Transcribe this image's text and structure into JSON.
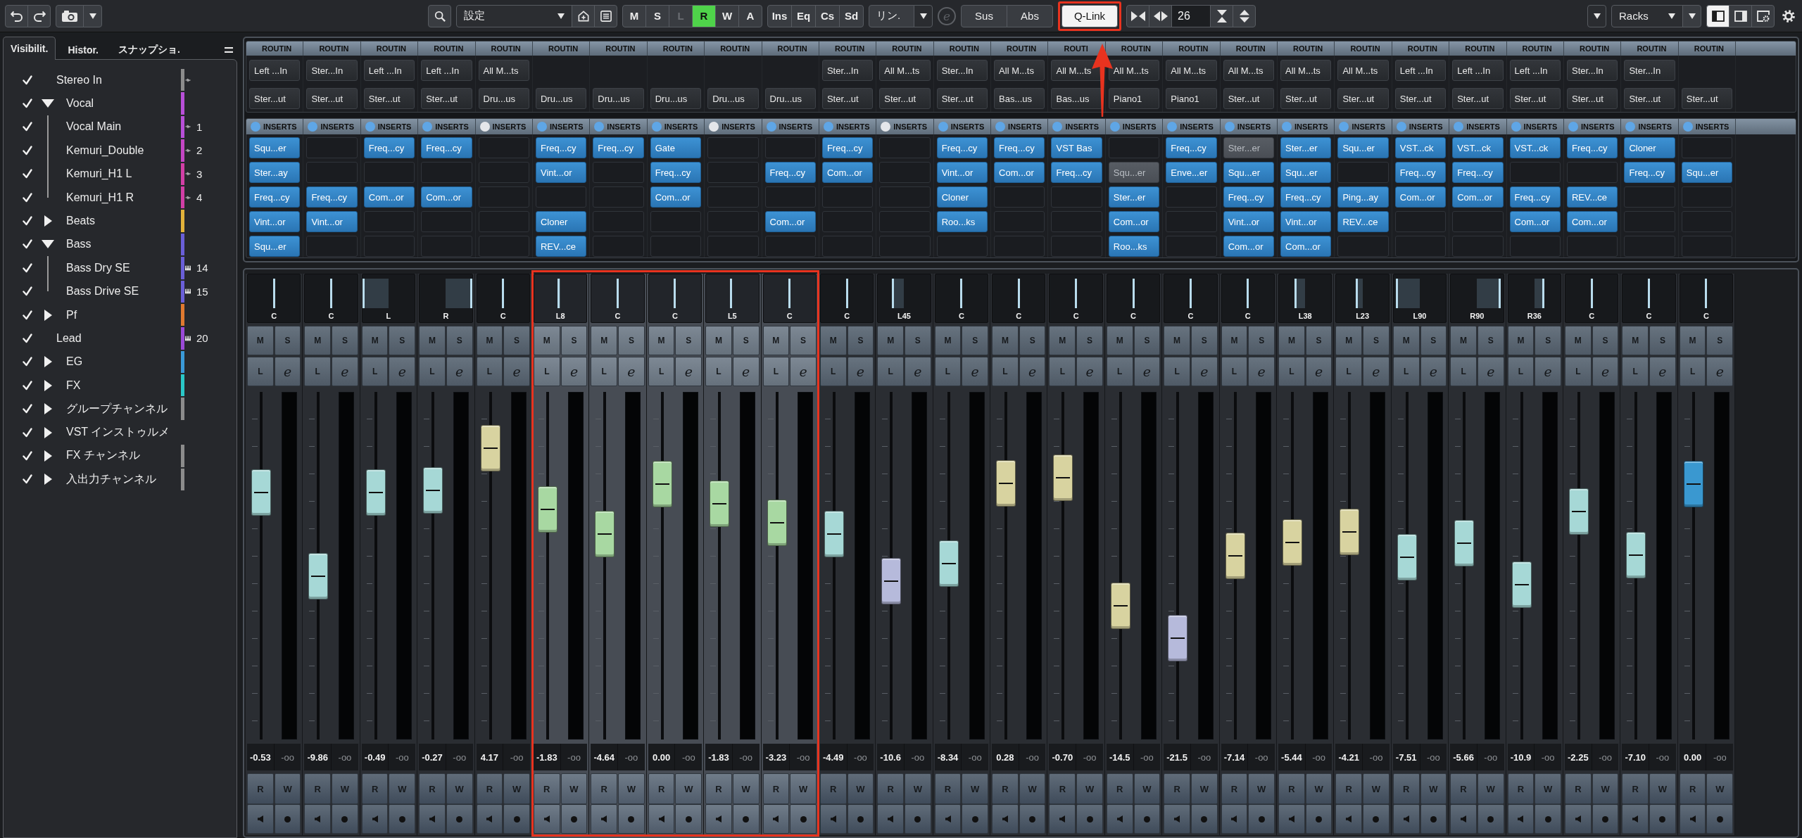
{
  "toolbar": {
    "config": {
      "value": "設定"
    },
    "modes": [
      {
        "label": "M",
        "on": false,
        "disabled": false
      },
      {
        "label": "S",
        "on": false,
        "disabled": false
      },
      {
        "label": "L",
        "on": false,
        "disabled": true
      },
      {
        "label": "R",
        "on": true,
        "disabled": false
      },
      {
        "label": "W",
        "on": false,
        "disabled": false
      },
      {
        "label": "A",
        "on": false,
        "disabled": false
      }
    ],
    "racks": [
      {
        "label": "Ins"
      },
      {
        "label": "Eq"
      },
      {
        "label": "Cs"
      },
      {
        "label": "Sd"
      }
    ],
    "link": {
      "value": "リン."
    },
    "edit": {
      "label": "e",
      "disabled": true
    },
    "scope": [
      {
        "label": "Sus"
      },
      {
        "label": "Abs"
      }
    ],
    "qlink": {
      "label": "Q-Link",
      "on": true
    },
    "channel_count": "26",
    "rack_menu": {
      "value": "Racks"
    },
    "layout": [
      {
        "selected": true
      },
      {
        "selected": false
      },
      {
        "selected": false
      }
    ]
  },
  "sidebar": {
    "tabs": [
      {
        "label": "Visibilit.",
        "selected": true
      },
      {
        "label": "Histor.",
        "selected": false
      },
      {
        "label": "スナップショ.",
        "selected": false
      }
    ],
    "tree": [
      {
        "label": "Stereo In",
        "kind": "audio",
        "visible": true,
        "color": "#8c8c8c"
      },
      {
        "label": "Vocal",
        "kind": "folder",
        "visible": true,
        "expanded": true,
        "color": "#b84fd8",
        "children": [
          {
            "label": "Vocal Main",
            "kind": "audio",
            "visible": true,
            "color": "#b84fd8",
            "number": "1"
          },
          {
            "label": "Kemuri_Double",
            "kind": "audio",
            "visible": true,
            "color": "#c446c4",
            "number": "2"
          },
          {
            "label": "Kemuri_H1 L",
            "kind": "audio",
            "visible": true,
            "color": "#d23fa6",
            "number": "3"
          },
          {
            "label": "Kemuri_H1 R",
            "kind": "audio",
            "visible": true,
            "color": "#d23fa6",
            "number": "4"
          }
        ]
      },
      {
        "label": "Beats",
        "kind": "folder",
        "visible": true,
        "expanded": false,
        "color": "#e2b23a"
      },
      {
        "label": "Bass",
        "kind": "folder",
        "visible": true,
        "expanded": true,
        "color": "#6a5fd8",
        "children": [
          {
            "label": "Bass Dry SE",
            "kind": "instrument",
            "visible": true,
            "color": "#6a5fd8",
            "number": "14"
          },
          {
            "label": "Bass Drive SE",
            "kind": "instrument",
            "visible": true,
            "color": "#6a5fd8",
            "number": "15"
          }
        ]
      },
      {
        "label": "Pf",
        "kind": "folder",
        "visible": true,
        "expanded": false,
        "color": "#e07a30"
      },
      {
        "label": "Lead",
        "kind": "instrument",
        "visible": true,
        "color": "#9a4ad8",
        "number": "20"
      },
      {
        "label": "EG",
        "kind": "folder",
        "visible": true,
        "expanded": false,
        "color": "#3a9ad8"
      },
      {
        "label": "FX",
        "kind": "folder",
        "visible": true,
        "expanded": false,
        "color": "#2ac8c8"
      },
      {
        "label": "グループチャンネル",
        "kind": "folder",
        "visible": true,
        "expanded": false,
        "color": "#8c8c8c"
      },
      {
        "label": "VST インストゥルメ",
        "kind": "folder",
        "visible": true,
        "expanded": false
      },
      {
        "label": "FX チャンネル",
        "kind": "folder",
        "visible": true,
        "expanded": false,
        "color": "#8c8c8c"
      },
      {
        "label": "入出力チャンネル",
        "kind": "folder",
        "visible": true,
        "expanded": false,
        "color": "#8c8c8c"
      }
    ]
  },
  "rack": {
    "columns": [
      {
        "routing_label": "ROUTIN",
        "input": "Left ...In",
        "output": "Ster...ut",
        "inserts_label": "INSERTS",
        "inserts_on": true,
        "inserts": [
          {
            "kind": "plugin",
            "name": "Squ...er"
          },
          {
            "kind": "plugin",
            "name": "Ster...ay"
          },
          {
            "kind": "plugin",
            "name": "Freq...cy"
          },
          {
            "kind": "plugin",
            "name": "Vint...or"
          },
          {
            "kind": "plugin",
            "name": "Squ...er"
          }
        ]
      },
      {
        "routing_label": "ROUTIN",
        "input": "Ster...In",
        "output": "Ster...ut",
        "inserts_label": "INSERTS",
        "inserts_on": true,
        "inserts": [
          {
            "kind": "empty"
          },
          {
            "kind": "empty"
          },
          {
            "kind": "plugin",
            "name": "Freq...cy"
          },
          {
            "kind": "plugin",
            "name": "Vint...or"
          },
          {
            "kind": "empty"
          }
        ]
      },
      {
        "routing_label": "ROUTIN",
        "input": "Left ...In",
        "output": "Ster...ut",
        "inserts_label": "INSERTS",
        "inserts_on": true,
        "inserts": [
          {
            "kind": "plugin",
            "name": "Freq...cy"
          },
          {
            "kind": "empty"
          },
          {
            "kind": "plugin",
            "name": "Com...or"
          },
          {
            "kind": "empty"
          },
          {
            "kind": "empty"
          }
        ]
      },
      {
        "routing_label": "ROUTIN",
        "input": "Left ...In",
        "output": "Ster...ut",
        "inserts_label": "INSERTS",
        "inserts_on": true,
        "inserts": [
          {
            "kind": "plugin",
            "name": "Freq...cy"
          },
          {
            "kind": "empty"
          },
          {
            "kind": "plugin",
            "name": "Com...or"
          },
          {
            "kind": "empty"
          },
          {
            "kind": "empty"
          }
        ]
      },
      {
        "routing_label": "ROUTIN",
        "input": "All M...ts",
        "output": "Dru...us",
        "inserts_label": "INSERTS",
        "inserts_on": false,
        "inserts": [
          {
            "kind": "empty"
          },
          {
            "kind": "empty"
          },
          {
            "kind": "empty"
          },
          {
            "kind": "empty"
          },
          {
            "kind": "empty"
          }
        ]
      },
      {
        "routing_label": "ROUTIN",
        "output": "Dru...us",
        "inserts_label": "INSERTS",
        "inserts_on": true,
        "inserts": [
          {
            "kind": "plugin",
            "name": "Freq...cy"
          },
          {
            "kind": "plugin",
            "name": "Vint...or"
          },
          {
            "kind": "empty"
          },
          {
            "kind": "plugin",
            "name": "Cloner"
          },
          {
            "kind": "plugin",
            "name": "REV...ce"
          }
        ]
      },
      {
        "routing_label": "ROUTIN",
        "output": "Dru...us",
        "inserts_label": "INSERTS",
        "inserts_on": true,
        "inserts": [
          {
            "kind": "plugin",
            "name": "Freq...cy"
          },
          {
            "kind": "empty"
          },
          {
            "kind": "empty"
          },
          {
            "kind": "empty"
          },
          {
            "kind": "empty"
          }
        ]
      },
      {
        "routing_label": "ROUTIN",
        "output": "Dru...us",
        "inserts_label": "INSERTS",
        "inserts_on": true,
        "inserts": [
          {
            "kind": "plugin",
            "name": "Gate"
          },
          {
            "kind": "plugin",
            "name": "Freq...cy"
          },
          {
            "kind": "plugin",
            "name": "Com...or"
          },
          {
            "kind": "empty"
          },
          {
            "kind": "empty"
          }
        ]
      },
      {
        "routing_label": "ROUTIN",
        "output": "Dru...us",
        "inserts_label": "INSERTS",
        "inserts_on": false,
        "inserts": [
          {
            "kind": "empty"
          },
          {
            "kind": "empty"
          },
          {
            "kind": "empty"
          },
          {
            "kind": "empty"
          },
          {
            "kind": "empty"
          }
        ]
      },
      {
        "routing_label": "ROUTIN",
        "output": "Dru...us",
        "inserts_label": "INSERTS",
        "inserts_on": true,
        "inserts": [
          {
            "kind": "empty"
          },
          {
            "kind": "plugin",
            "name": "Freq...cy"
          },
          {
            "kind": "empty"
          },
          {
            "kind": "plugin",
            "name": "Com...or"
          },
          {
            "kind": "empty"
          }
        ]
      },
      {
        "routing_label": "ROUTIN",
        "input": "Ster...In",
        "output": "Ster...ut",
        "inserts_label": "INSERTS",
        "inserts_on": true,
        "inserts": [
          {
            "kind": "plugin",
            "name": "Freq...cy"
          },
          {
            "kind": "plugin",
            "name": "Com...or"
          },
          {
            "kind": "empty"
          },
          {
            "kind": "empty"
          },
          {
            "kind": "empty"
          }
        ]
      },
      {
        "routing_label": "ROUTIN",
        "input": "All M...ts",
        "output": "Ster...ut",
        "inserts_label": "INSERTS",
        "inserts_on": false,
        "inserts": [
          {
            "kind": "empty"
          },
          {
            "kind": "empty"
          },
          {
            "kind": "empty"
          },
          {
            "kind": "empty"
          },
          {
            "kind": "empty"
          }
        ]
      },
      {
        "routing_label": "ROUTIN",
        "input": "Ster...In",
        "output": "Ster...ut",
        "inserts_label": "INSERTS",
        "inserts_on": true,
        "inserts": [
          {
            "kind": "plugin",
            "name": "Freq...cy"
          },
          {
            "kind": "plugin",
            "name": "Vint...or"
          },
          {
            "kind": "plugin",
            "name": "Cloner"
          },
          {
            "kind": "plugin",
            "name": "Roo...ks"
          },
          {
            "kind": "empty"
          }
        ]
      },
      {
        "routing_label": "ROUTIN",
        "input": "All M...ts",
        "output": "Bas...us",
        "inserts_label": "INSERTS",
        "inserts_on": true,
        "inserts": [
          {
            "kind": "plugin",
            "name": "Freq...cy"
          },
          {
            "kind": "plugin",
            "name": "Com...or"
          },
          {
            "kind": "empty"
          },
          {
            "kind": "empty"
          },
          {
            "kind": "empty"
          }
        ]
      },
      {
        "routing_label": "ROUTI",
        "input": "All M...ts",
        "output": "Bas...us",
        "inserts_label": "INSERTS",
        "inserts_on": true,
        "inserts": [
          {
            "kind": "plugin",
            "name": "VST Bas"
          },
          {
            "kind": "plugin",
            "name": "Freq...cy"
          },
          {
            "kind": "empty"
          },
          {
            "kind": "empty"
          },
          {
            "kind": "empty"
          }
        ]
      },
      {
        "routing_label": "ROUTIN",
        "input": "All M...ts",
        "output": "Piano1",
        "inserts_label": "INSERTS",
        "inserts_on": true,
        "inserts": [
          {
            "kind": "empty"
          },
          {
            "kind": "bypassed",
            "name": "Squ...er"
          },
          {
            "kind": "plugin",
            "name": "Ster...er"
          },
          {
            "kind": "plugin",
            "name": "Com...or"
          },
          {
            "kind": "plugin",
            "name": "Roo...ks"
          }
        ]
      },
      {
        "routing_label": "ROUTIN",
        "input": "All M...ts",
        "output": "Piano1",
        "inserts_label": "INSERTS",
        "inserts_on": true,
        "inserts": [
          {
            "kind": "plugin",
            "name": "Freq...cy"
          },
          {
            "kind": "plugin",
            "name": "Enve...er"
          },
          {
            "kind": "empty"
          },
          {
            "kind": "empty"
          },
          {
            "kind": "empty"
          }
        ]
      },
      {
        "routing_label": "ROUTIN",
        "input": "All M...ts",
        "output": "Ster...ut",
        "inserts_label": "INSERTS",
        "inserts_on": true,
        "inserts": [
          {
            "kind": "bypassed",
            "name": "Ster...er"
          },
          {
            "kind": "plugin",
            "name": "Squ...er"
          },
          {
            "kind": "plugin",
            "name": "Freq...cy"
          },
          {
            "kind": "plugin",
            "name": "Vint...or"
          },
          {
            "kind": "plugin",
            "name": "Com...or"
          }
        ]
      },
      {
        "routing_label": "ROUTIN",
        "input": "All M...ts",
        "output": "Ster...ut",
        "inserts_label": "INSERTS",
        "inserts_on": true,
        "inserts": [
          {
            "kind": "plugin",
            "name": "Ster...er"
          },
          {
            "kind": "plugin",
            "name": "Squ...er"
          },
          {
            "kind": "plugin",
            "name": "Freq...cy"
          },
          {
            "kind": "plugin",
            "name": "Vint...or"
          },
          {
            "kind": "plugin",
            "name": "Com...or"
          }
        ]
      },
      {
        "routing_label": "ROUTIN",
        "input": "All M...ts",
        "output": "Ster...ut",
        "inserts_label": "INSERTS",
        "inserts_on": true,
        "inserts": [
          {
            "kind": "plugin",
            "name": "Squ...er"
          },
          {
            "kind": "empty"
          },
          {
            "kind": "plugin",
            "name": "Ping...ay"
          },
          {
            "kind": "plugin",
            "name": "REV...ce"
          },
          {
            "kind": "empty"
          }
        ]
      },
      {
        "routing_label": "ROUTIN",
        "input": "Left ...In",
        "output": "Ster...ut",
        "inserts_label": "INSERTS",
        "inserts_on": true,
        "inserts": [
          {
            "kind": "plugin",
            "name": "VST...ck"
          },
          {
            "kind": "plugin",
            "name": "Freq...cy"
          },
          {
            "kind": "plugin",
            "name": "Com...or"
          },
          {
            "kind": "empty"
          },
          {
            "kind": "empty"
          }
        ]
      },
      {
        "routing_label": "ROUTIN",
        "input": "Left ...In",
        "output": "Ster...ut",
        "inserts_label": "INSERTS",
        "inserts_on": true,
        "inserts": [
          {
            "kind": "plugin",
            "name": "VST...ck"
          },
          {
            "kind": "plugin",
            "name": "Freq...cy"
          },
          {
            "kind": "plugin",
            "name": "Com...or"
          },
          {
            "kind": "empty"
          },
          {
            "kind": "empty"
          }
        ]
      },
      {
        "routing_label": "ROUTIN",
        "input": "Left ...In",
        "output": "Ster...ut",
        "inserts_label": "INSERTS",
        "inserts_on": true,
        "inserts": [
          {
            "kind": "plugin",
            "name": "VST...ck"
          },
          {
            "kind": "empty"
          },
          {
            "kind": "plugin",
            "name": "Freq...cy"
          },
          {
            "kind": "plugin",
            "name": "Com...or"
          },
          {
            "kind": "empty"
          }
        ]
      },
      {
        "routing_label": "ROUTIN",
        "input": "Ster...In",
        "output": "Ster...ut",
        "inserts_label": "INSERTS",
        "inserts_on": true,
        "inserts": [
          {
            "kind": "plugin",
            "name": "Freq...cy"
          },
          {
            "kind": "empty"
          },
          {
            "kind": "plugin",
            "name": "REV...ce"
          },
          {
            "kind": "plugin",
            "name": "Com...or"
          },
          {
            "kind": "empty"
          }
        ]
      },
      {
        "routing_label": "ROUTIN",
        "input": "Ster...In",
        "output": "Ster...ut",
        "inserts_label": "INSERTS",
        "inserts_on": true,
        "inserts": [
          {
            "kind": "plugin",
            "name": "Cloner"
          },
          {
            "kind": "plugin",
            "name": "Freq...cy"
          },
          {
            "kind": "empty"
          },
          {
            "kind": "empty"
          },
          {
            "kind": "empty"
          }
        ]
      },
      {
        "routing_label": "ROUTIN",
        "output": "Ster...ut",
        "inserts_label": "INSERTS",
        "inserts_on": true,
        "inserts": [
          {
            "kind": "empty"
          },
          {
            "kind": "plugin",
            "name": "Squ...er"
          },
          {
            "kind": "empty"
          },
          {
            "kind": "empty"
          },
          {
            "kind": "empty"
          }
        ]
      }
    ]
  },
  "channels": [
    {
      "pan": {
        "label": "C",
        "level": 0.5
      },
      "controls": [
        "M",
        "S",
        "L",
        "e"
      ],
      "fader": {
        "level": 0.743
      },
      "color": "#a6d8d6",
      "volume": "-0.53",
      "peak": "-oo",
      "automation": [
        "R",
        "W"
      ],
      "selected": false
    },
    {
      "pan": {
        "label": "C",
        "level": 0.5
      },
      "controls": [
        "M",
        "S",
        "L",
        "e"
      ],
      "fader": {
        "level": 0.464
      },
      "color": "#a6d8d6",
      "volume": "-9.86",
      "peak": "-oo",
      "automation": [
        "R",
        "W"
      ],
      "selected": false
    },
    {
      "pan": {
        "label": "L",
        "level": 0
      },
      "controls": [
        "M",
        "S",
        "L",
        "e"
      ],
      "fader": {
        "level": 0.743
      },
      "color": "#a6d8d6",
      "volume": "-0.49",
      "peak": "-oo",
      "automation": [
        "R",
        "W"
      ],
      "selected": false
    },
    {
      "pan": {
        "label": "R",
        "level": 1
      },
      "controls": [
        "M",
        "S",
        "L",
        "e"
      ],
      "fader": {
        "level": 0.751
      },
      "color": "#a6d8d6",
      "volume": "-0.27",
      "peak": "-oo",
      "automation": [
        "R",
        "W"
      ],
      "selected": false
    },
    {
      "pan": {
        "label": "C",
        "level": 0.5
      },
      "controls": [
        "M",
        "S",
        "L",
        "e"
      ],
      "fader": {
        "level": 0.891
      },
      "color": "#d8d3a0",
      "volume": "4.17",
      "peak": "-oo",
      "automation": [
        "R",
        "W"
      ],
      "selected": false
    },
    {
      "pan": {
        "label": "L8",
        "level": 0.46
      },
      "controls": [
        "M",
        "S",
        "L",
        "e"
      ],
      "fader": {
        "level": 0.687
      },
      "color": "#a8d8a2",
      "volume": "-1.83",
      "peak": "-oo",
      "automation": [
        "R",
        "W"
      ],
      "selected": true
    },
    {
      "pan": {
        "label": "C",
        "level": 0.5
      },
      "controls": [
        "M",
        "S",
        "L",
        "e"
      ],
      "fader": {
        "level": 0.604
      },
      "color": "#a8d8a2",
      "volume": "-4.64",
      "peak": "-oo",
      "automation": [
        "R",
        "W"
      ],
      "selected": true
    },
    {
      "pan": {
        "label": "C",
        "level": 0.5
      },
      "controls": [
        "M",
        "S",
        "L",
        "e"
      ],
      "fader": {
        "level": 0.77
      },
      "color": "#a8d8a2",
      "volume": "0.00",
      "peak": "-oo",
      "automation": [
        "R",
        "W"
      ],
      "selected": true
    },
    {
      "pan": {
        "label": "L5",
        "level": 0.475
      },
      "controls": [
        "M",
        "S",
        "L",
        "e"
      ],
      "fader": {
        "level": 0.706
      },
      "color": "#a8d8a2",
      "volume": "-1.83",
      "peak": "-oo",
      "automation": [
        "R",
        "W"
      ],
      "selected": true
    },
    {
      "pan": {
        "label": "C",
        "level": 0.5
      },
      "controls": [
        "M",
        "S",
        "L",
        "e"
      ],
      "fader": {
        "level": 0.642
      },
      "color": "#a8d8a2",
      "volume": "-3.23",
      "peak": "-oo",
      "automation": [
        "R",
        "W"
      ],
      "selected": true
    },
    {
      "pan": {
        "label": "C",
        "level": 0.5
      },
      "controls": [
        "M",
        "S",
        "L",
        "e"
      ],
      "fader": {
        "level": 0.604
      },
      "color": "#a6d8d6",
      "volume": "-4.49",
      "peak": "-oo",
      "automation": [
        "R",
        "W"
      ],
      "selected": false
    },
    {
      "pan": {
        "label": "L45",
        "level": 0.275
      },
      "controls": [
        "M",
        "S",
        "L",
        "e"
      ],
      "fader": {
        "level": 0.449
      },
      "color": "#b6badb",
      "volume": "-10.6",
      "peak": "-oo",
      "automation": [
        "R",
        "W"
      ],
      "selected": false
    },
    {
      "pan": {
        "label": "C",
        "level": 0.5
      },
      "controls": [
        "M",
        "S",
        "L",
        "e"
      ],
      "fader": {
        "level": 0.506
      },
      "color": "#a6d8d6",
      "volume": "-8.34",
      "peak": "-oo",
      "automation": [
        "R",
        "W"
      ],
      "selected": false
    },
    {
      "pan": {
        "label": "C",
        "level": 0.5
      },
      "controls": [
        "M",
        "S",
        "L",
        "e"
      ],
      "fader": {
        "level": 0.774
      },
      "color": "#d8d3a0",
      "volume": "0.28",
      "peak": "-oo",
      "automation": [
        "R",
        "W"
      ],
      "selected": false
    },
    {
      "pan": {
        "label": "C",
        "level": 0.5
      },
      "controls": [
        "M",
        "S",
        "L",
        "e"
      ],
      "fader": {
        "level": 0.792
      },
      "color": "#d8d3a0",
      "volume": "-0.70",
      "peak": "-oo",
      "automation": [
        "R",
        "W"
      ],
      "selected": false
    },
    {
      "pan": {
        "label": "C",
        "level": 0.5
      },
      "controls": [
        "M",
        "S",
        "L",
        "e"
      ],
      "fader": {
        "level": 0.366
      },
      "color": "#d8d3a0",
      "volume": "-14.5",
      "peak": "-oo",
      "automation": [
        "R",
        "W"
      ],
      "selected": false
    },
    {
      "pan": {
        "label": "C",
        "level": 0.5
      },
      "controls": [
        "M",
        "S",
        "L",
        "e"
      ],
      "fader": {
        "level": 0.26
      },
      "color": "#b6badb",
      "volume": "-21.5",
      "peak": "-oo",
      "automation": [
        "R",
        "W"
      ],
      "selected": false
    },
    {
      "pan": {
        "label": "C",
        "level": 0.5
      },
      "controls": [
        "M",
        "S",
        "L",
        "e"
      ],
      "fader": {
        "level": 0.532
      },
      "color": "#d8d3a0",
      "volume": "-7.14",
      "peak": "-oo",
      "automation": [
        "R",
        "W"
      ],
      "selected": false
    },
    {
      "pan": {
        "label": "L38",
        "level": 0.31
      },
      "controls": [
        "M",
        "S",
        "L",
        "e"
      ],
      "fader": {
        "level": 0.577
      },
      "color": "#d8d3a0",
      "volume": "-5.44",
      "peak": "-oo",
      "automation": [
        "R",
        "W"
      ],
      "selected": false
    },
    {
      "pan": {
        "label": "L23",
        "level": 0.385
      },
      "controls": [
        "M",
        "S",
        "L",
        "e"
      ],
      "fader": {
        "level": 0.611
      },
      "color": "#d8d3a0",
      "volume": "-4.21",
      "peak": "-oo",
      "automation": [
        "R",
        "W"
      ],
      "selected": false
    },
    {
      "pan": {
        "label": "L90",
        "level": 0.05
      },
      "controls": [
        "M",
        "S",
        "L",
        "e"
      ],
      "fader": {
        "level": 0.528
      },
      "color": "#a6d8d6",
      "volume": "-7.51",
      "peak": "-oo",
      "automation": [
        "R",
        "W"
      ],
      "selected": false
    },
    {
      "pan": {
        "label": "R90",
        "level": 0.95
      },
      "controls": [
        "M",
        "S",
        "L",
        "e"
      ],
      "fader": {
        "level": 0.574
      },
      "color": "#a6d8d6",
      "volume": "-5.66",
      "peak": "-oo",
      "automation": [
        "R",
        "W"
      ],
      "selected": false
    },
    {
      "pan": {
        "label": "R36",
        "level": 0.68
      },
      "controls": [
        "M",
        "S",
        "L",
        "e"
      ],
      "fader": {
        "level": 0.438
      },
      "color": "#a6d8d6",
      "volume": "-10.9",
      "peak": "-oo",
      "automation": [
        "R",
        "W"
      ],
      "selected": false
    },
    {
      "pan": {
        "label": "C",
        "level": 0.5
      },
      "controls": [
        "M",
        "S",
        "L",
        "e"
      ],
      "fader": {
        "level": 0.679
      },
      "color": "#a6d8d6",
      "volume": "-2.25",
      "peak": "-oo",
      "automation": [
        "R",
        "W"
      ],
      "selected": false
    },
    {
      "pan": {
        "label": "C",
        "level": 0.5
      },
      "controls": [
        "M",
        "S",
        "L",
        "e"
      ],
      "fader": {
        "level": 0.536
      },
      "color": "#a6d8d6",
      "volume": "-7.10",
      "peak": "-oo",
      "automation": [
        "R",
        "W"
      ],
      "selected": false
    },
    {
      "pan": {
        "label": "C",
        "level": 0.5
      },
      "controls": [
        "M",
        "S",
        "L",
        "e"
      ],
      "fader": {
        "level": 0.77
      },
      "color": "#3a98d0",
      "volume": "0.00",
      "peak": "-oo",
      "automation": [
        "R",
        "W"
      ],
      "selected": false
    }
  ],
  "annotations": {
    "qlink_outline": true,
    "arrow": true,
    "selection_outline": true
  }
}
